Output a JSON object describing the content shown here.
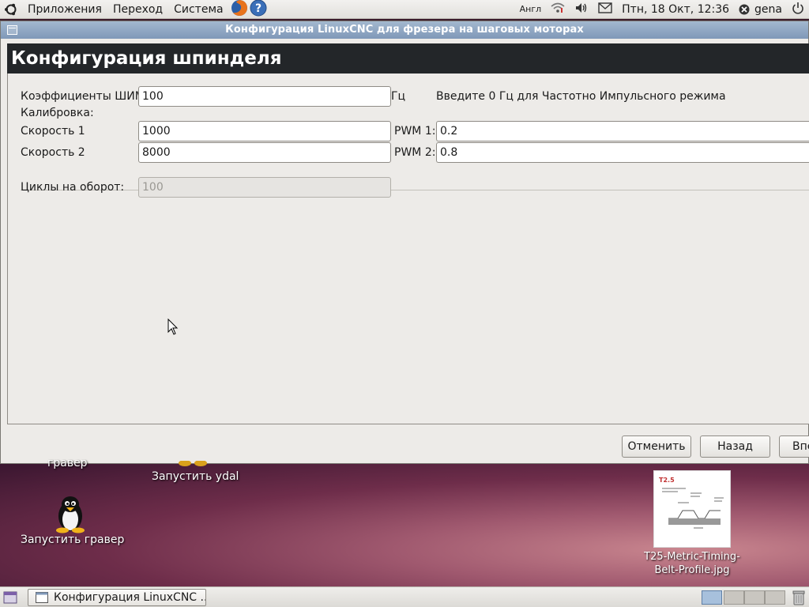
{
  "top_panel": {
    "menus": [
      "Приложения",
      "Переход",
      "Система"
    ],
    "lang": "Англ",
    "datetime": "Птн, 18 Окт, 12:36",
    "user": "gena"
  },
  "window": {
    "title": "Конфигурация LinuxCNC для фрезера на шаговых моторах",
    "header": "Конфигурация шпинделя",
    "pwm_label": "Коэффициенты ШИМ",
    "pwm_value": "100",
    "pwm_unit": "Гц",
    "pwm_hint": "Введите 0 Гц для Частотно Импульсного режима",
    "calibration_label": "Калибровка:",
    "speed1_label": "Скорость 1",
    "speed1_value": "1000",
    "pwm1_label": "PWM 1:",
    "pwm1_value": "0.2",
    "speed2_label": "Скорость 2",
    "speed2_value": "8000",
    "pwm2_label": "PWM 2:",
    "pwm2_value": "0.8",
    "cycles_label": "Циклы на оборот:",
    "cycles_value": "100",
    "buttons": {
      "cancel": "Отменить",
      "back": "Назад",
      "forward": "Впе"
    }
  },
  "desktop": {
    "icons": [
      {
        "label": "гравер"
      },
      {
        "label": "Запустить ydal"
      },
      {
        "label": "Запустить гравер"
      },
      {
        "label": "T25-Metric-Timing-Belt-Profile.jpg"
      }
    ],
    "thumb_text": "T2.5"
  },
  "taskbar": {
    "task_label": "Конфигурация LinuxCNC ..."
  },
  "colors": {
    "header_bg": "#232629",
    "titlebar": "#8fa6c4",
    "desktop": "#8a4460"
  }
}
